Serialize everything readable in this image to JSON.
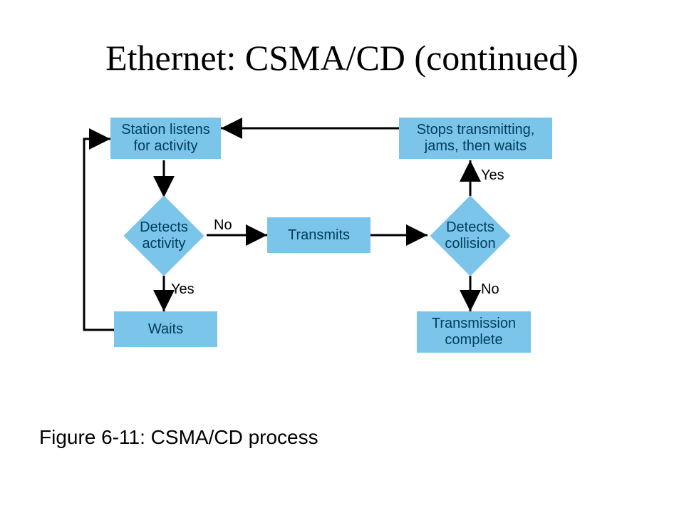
{
  "title": "Ethernet: CSMA/CD (continued)",
  "caption": "Figure 6-11: CSMA/CD process",
  "nodes": {
    "listen": "Station listens for activity",
    "stops": "Stops transmitting, jams, then waits",
    "detectAct": "Detects activity",
    "transmits": "Transmits",
    "detectCol": "Detects collision",
    "waits": "Waits",
    "txDone": "Transmission complete"
  },
  "edges": {
    "no": "No",
    "yes1": "Yes",
    "yes2": "Yes",
    "no2": "No"
  }
}
